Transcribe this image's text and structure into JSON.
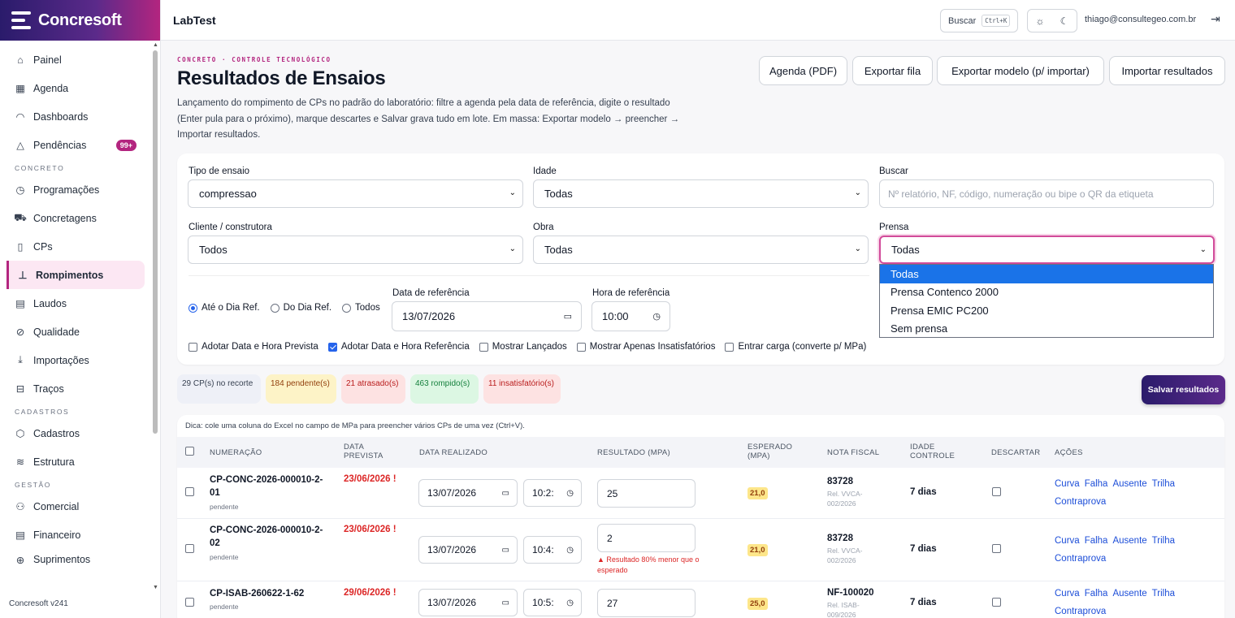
{
  "brand": "Concresoft",
  "version": "Concresoft v241",
  "topbar": {
    "app_title": "LabTest",
    "search_label": "Buscar",
    "search_kbd": "Ctrl+K",
    "user_email": "thiago@consultegeo.com.br"
  },
  "sidebar": {
    "items_top": [
      {
        "label": "Painel",
        "icon": "home-icon"
      },
      {
        "label": "Agenda",
        "icon": "calendar-icon"
      },
      {
        "label": "Dashboards",
        "icon": "gauge-icon"
      },
      {
        "label": "Pendências",
        "icon": "warning-icon",
        "badge": "99+"
      }
    ],
    "section_concreto": "CONCRETO",
    "items_concreto": [
      {
        "label": "Programações",
        "icon": "clock-icon"
      },
      {
        "label": "Concretagens",
        "icon": "truck-icon"
      },
      {
        "label": "CPs",
        "icon": "cylinder-icon"
      },
      {
        "label": "Rompimentos",
        "icon": "press-icon",
        "active": true
      },
      {
        "label": "Laudos",
        "icon": "document-icon"
      },
      {
        "label": "Qualidade",
        "icon": "check-circle-icon"
      },
      {
        "label": "Importações",
        "icon": "download-icon"
      },
      {
        "label": "Traços",
        "icon": "layers-icon"
      }
    ],
    "section_cadastros": "CADASTROS",
    "items_cadastros": [
      {
        "label": "Cadastros",
        "icon": "box-icon"
      },
      {
        "label": "Estrutura",
        "icon": "stack-icon"
      }
    ],
    "section_gestao": "GESTÃO",
    "items_gestao": [
      {
        "label": "Comercial",
        "icon": "users-icon"
      },
      {
        "label": "Financeiro",
        "icon": "ledger-icon"
      },
      {
        "label": "Suprimentos",
        "icon": "cart-icon"
      }
    ]
  },
  "header": {
    "eyebrow": "CONCRETO · CONTROLE TECNOLÓGICO",
    "title": "Resultados de Ensaios",
    "description": "Lançamento do rompimento de CPs no padrão do laboratório: filtre a agenda pela data de referência, digite o resultado (Enter pula para o próximo), marque descartes e Salvar grava tudo em lote. Em massa: Exportar modelo → preencher → Importar resultados."
  },
  "actions": {
    "agenda_pdf": "Agenda (PDF)",
    "export_queue": "Exportar fila",
    "export_template": "Exportar modelo (p/ importar)",
    "import_results": "Importar resultados"
  },
  "filters": {
    "tipo_label": "Tipo de ensaio",
    "tipo_value": "compressao",
    "idade_label": "Idade",
    "idade_value": "Todas",
    "buscar_label": "Buscar",
    "buscar_placeholder": "Nº relatório, NF, código, numeração ou bipe o QR da etiqueta",
    "cliente_label": "Cliente / construtora",
    "cliente_value": "Todos",
    "obra_label": "Obra",
    "obra_value": "Todas",
    "prensa_label": "Prensa",
    "prensa_value": "Todas",
    "prensa_options": [
      "Todas",
      "Prensa Contenco 2000",
      "Prensa EMIC PC200",
      "Sem prensa"
    ],
    "radios": [
      "Até o Dia Ref.",
      "Do Dia Ref.",
      "Todos"
    ],
    "data_ref_label": "Data de referência",
    "data_ref_value": "13/07/2026",
    "hora_ref_label": "Hora de referência",
    "hora_ref_value": "10:00",
    "checkboxes": [
      {
        "label": "Adotar Data e Hora Prevista",
        "checked": false
      },
      {
        "label": "Adotar Data e Hora Referência",
        "checked": true
      },
      {
        "label": "Mostrar Lançados",
        "checked": false
      },
      {
        "label": "Mostrar Apenas Insatisfatórios",
        "checked": false
      },
      {
        "label": "Entrar carga (converte p/ MPa)",
        "checked": false
      }
    ]
  },
  "summary": {
    "recorte": "29 CP(s) no recorte",
    "pendentes": "184 pendente(s)",
    "atrasados": "21 atrasado(s)",
    "rompidos": "463 rompido(s)",
    "insatisfatorios": "11 insatisfatório(s)",
    "save": "Salvar resultados"
  },
  "table": {
    "tip": "Dica: cole uma coluna do Excel no campo de MPa para preencher vários CPs de uma vez (Ctrl+V).",
    "headers": {
      "numeracao": "NUMERAÇÃO",
      "data_prevista": "DATA PREVISTA",
      "data_realizado": "DATA REALIZADO",
      "resultado": "RESULTADO (MPA)",
      "esperado": "ESPERADO (MPA)",
      "nota_fiscal": "NOTA FISCAL",
      "idade_controle": "IDADE CONTROLE",
      "descartar": "DESCARTAR",
      "acoes": "AÇÕES"
    },
    "action_labels": [
      "Curva",
      "Falha",
      "Ausente",
      "Trilha",
      "Contraprova"
    ],
    "rows": [
      {
        "numeracao": "CP-CONC-2026-000010-2-01",
        "status": "pendente",
        "prevista": "23/06/2026 !",
        "data": "13/07/2026",
        "hora": "10:2:",
        "resultado": "25",
        "warn": "",
        "esperado": "21,0",
        "nf": "83728",
        "rel": "Rel. VVCA-002/2026",
        "idade": "7 dias"
      },
      {
        "numeracao": "CP-CONC-2026-000010-2-02",
        "status": "pendente",
        "prevista": "23/06/2026 !",
        "data": "13/07/2026",
        "hora": "10:4:",
        "resultado": "2",
        "warn": "▲ Resultado 80% menor que o esperado",
        "esperado": "21,0",
        "nf": "83728",
        "rel": "Rel. VVCA-002/2026",
        "idade": "7 dias"
      },
      {
        "numeracao": "CP-ISAB-260622-1-62",
        "status": "pendente",
        "prevista": "29/06/2026 !",
        "data": "13/07/2026",
        "hora": "10:5:",
        "resultado": "27",
        "warn": "",
        "esperado": "25,0",
        "nf": "NF-100020",
        "rel": "Rel. ISAB-009/2026",
        "idade": "7 dias"
      }
    ]
  }
}
